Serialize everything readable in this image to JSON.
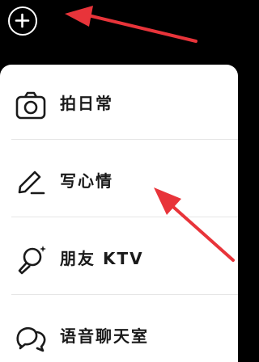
{
  "top_bar": {
    "plus_button": {
      "icon": "plus-circle-icon"
    }
  },
  "menu": {
    "items": [
      {
        "label": "拍日常",
        "icon": "camera-icon"
      },
      {
        "label": "写心情",
        "icon": "pencil-icon"
      },
      {
        "label": "朋友 KTV",
        "icon": "microphone-icon"
      },
      {
        "label": "语音聊天室",
        "icon": "chat-bubbles-icon"
      }
    ]
  },
  "annotation_color": "#e8343a"
}
